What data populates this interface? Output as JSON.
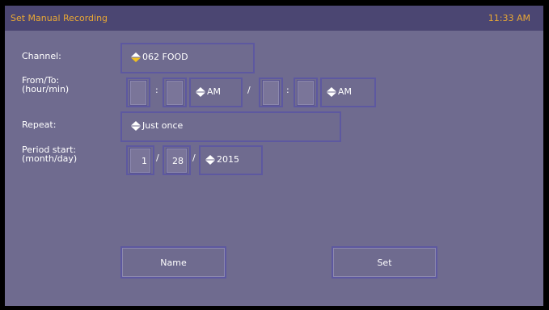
{
  "header": {
    "title": "Set Manual Recording",
    "clock": "11:33 AM"
  },
  "form": {
    "channel": {
      "label": "Channel:",
      "value": "062 FOOD"
    },
    "from_to": {
      "label_line1": "From/To:",
      "label_line2": "(hour/min)",
      "from": {
        "hour": "",
        "minute": "",
        "ampm": "AM"
      },
      "to": {
        "hour": "",
        "minute": "",
        "ampm": "AM"
      },
      "colon": ":",
      "slash": "/"
    },
    "repeat": {
      "label": "Repeat:",
      "value": "Just once"
    },
    "period_start": {
      "label_line1": "Period start:",
      "label_line2": "(month/day)",
      "month": "1",
      "day": "28",
      "year": "2015",
      "slash": "/"
    }
  },
  "buttons": {
    "name_label": "Name",
    "set_label": "Set"
  },
  "colors": {
    "background": "#6f6b8f",
    "titlebar": "#4b4672",
    "accent_text": "#e9a834",
    "arrow_active": "#f0c020",
    "field_border": "#5d58a0"
  }
}
